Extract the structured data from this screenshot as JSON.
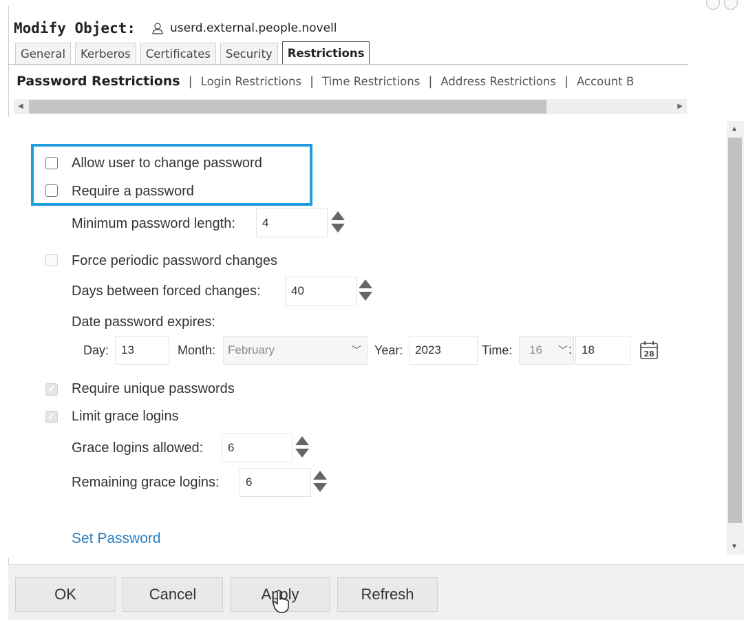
{
  "window": {
    "title_label": "Modify Object:",
    "object_name": "userd.external.people.novell",
    "user_icon": "user-icon"
  },
  "tabs": [
    {
      "label": "General",
      "active": false
    },
    {
      "label": "Kerberos",
      "active": false
    },
    {
      "label": "Certificates",
      "active": false
    },
    {
      "label": "Security",
      "active": false
    },
    {
      "label": "Restrictions",
      "active": true
    }
  ],
  "subtabs": [
    {
      "label": "Password Restrictions",
      "active": true
    },
    {
      "label": "Login Restrictions",
      "active": false
    },
    {
      "label": "Time Restrictions",
      "active": false
    },
    {
      "label": "Address Restrictions",
      "active": false
    },
    {
      "label": "Account B",
      "active": false
    }
  ],
  "subtab_separator": "|",
  "form": {
    "allow_change": {
      "label": "Allow user to change password",
      "checked": false
    },
    "require_password": {
      "label": "Require a password",
      "checked": false
    },
    "min_length": {
      "label": "Minimum password length:",
      "value": "4"
    },
    "force_periodic": {
      "label": "Force periodic password changes",
      "checked": false,
      "disabled": true
    },
    "days_between": {
      "label": "Days between forced changes:",
      "value": "40"
    },
    "date_expires": {
      "label": "Date password expires:",
      "day_label": "Day:",
      "day": "13",
      "month_label": "Month:",
      "month": "February",
      "year_label": "Year:",
      "year": "2023",
      "time_label": "Time:",
      "hour": "16",
      "time_sep": ":",
      "minute": "18",
      "calendar_icon": "calendar-icon",
      "calendar_day": "28"
    },
    "unique_passwords": {
      "label": "Require unique passwords",
      "checked": true,
      "disabled": true
    },
    "limit_grace": {
      "label": "Limit grace logins",
      "checked": true,
      "disabled": true
    },
    "grace_allowed": {
      "label": "Grace logins allowed:",
      "value": "6"
    },
    "grace_remaining": {
      "label": "Remaining grace logins:",
      "value": "6"
    },
    "set_password_link": "Set Password"
  },
  "buttons": {
    "ok": "OK",
    "cancel": "Cancel",
    "apply": "Apply",
    "refresh": "Refresh"
  },
  "colors": {
    "highlight": "#1f9ce0",
    "link": "#2a7fc1"
  }
}
